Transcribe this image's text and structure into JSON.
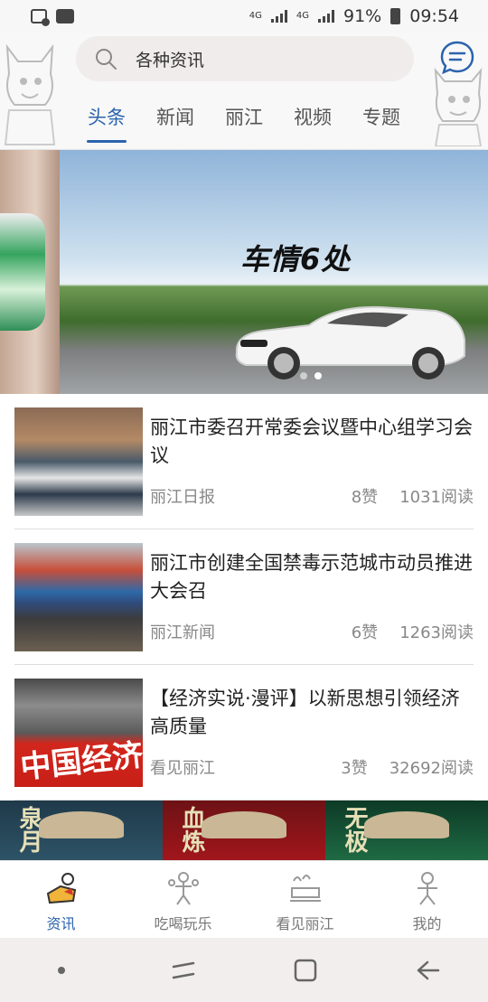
{
  "status_bar": {
    "network_type": "4G",
    "network_type_2": "4G",
    "battery": "91%",
    "time": "09:54"
  },
  "search": {
    "placeholder": "各种资讯"
  },
  "tabs": [
    {
      "label": "头条",
      "active": true
    },
    {
      "label": "新闻",
      "active": false
    },
    {
      "label": "丽江",
      "active": false
    },
    {
      "label": "视频",
      "active": false
    },
    {
      "label": "专题",
      "active": false
    }
  ],
  "banner": {
    "logo_text": "车情6处",
    "slide_count": 2,
    "active_slide": 2
  },
  "news": [
    {
      "title": "丽江市委召开常委会议暨中心组学习会议",
      "source": "丽江日报",
      "likes": "8赞",
      "reads": "1031阅读"
    },
    {
      "title": "丽江市创建全国禁毒示范城市动员推进大会召",
      "source": "丽江新闻",
      "likes": "6赞",
      "reads": "1263阅读"
    },
    {
      "title": "【经济实说·漫评】以新思想引领经济高质量",
      "source": "看见丽江",
      "likes": "3赞",
      "reads": "32692阅读",
      "thumb_text": "中国经济"
    }
  ],
  "promos": [
    {
      "text": "泉月"
    },
    {
      "text": "血炼"
    },
    {
      "text": "无极"
    }
  ],
  "bottom_nav": [
    {
      "label": "资讯",
      "icon": "news-icon",
      "active": true
    },
    {
      "label": "吃喝玩乐",
      "icon": "leisure-icon",
      "active": false
    },
    {
      "label": "看见丽江",
      "icon": "landmark-icon",
      "active": false
    },
    {
      "label": "我的",
      "icon": "profile-icon",
      "active": false
    }
  ],
  "colors": {
    "accent": "#2b63ad",
    "text": "#222222",
    "meta": "#888888"
  }
}
